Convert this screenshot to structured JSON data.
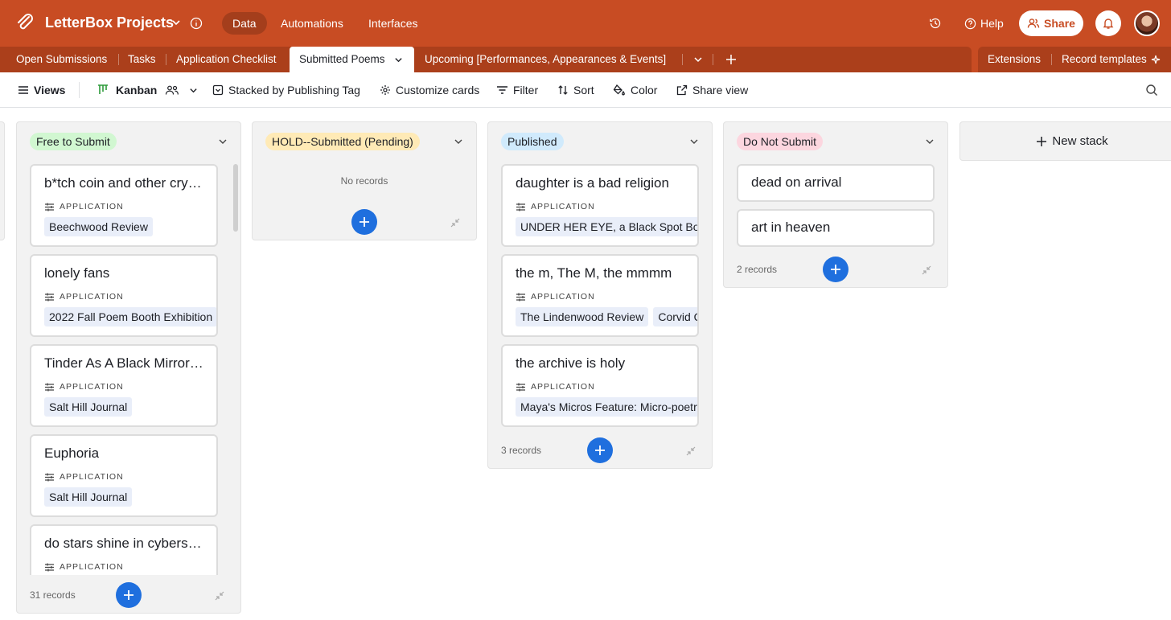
{
  "app": {
    "base_name": "LetterBox Projects",
    "nav": [
      "Data",
      "Automations",
      "Interfaces"
    ],
    "help_label": "Help",
    "share_label": "Share",
    "brand_color": "#c84c23"
  },
  "tabs": {
    "items": [
      "Open Submissions",
      "Tasks",
      "Application Checklist",
      "Submitted Poems",
      "Upcoming [Performances, Appearances & Events]"
    ],
    "active": "Submitted Poems",
    "extensions_label": "Extensions",
    "record_templates_label": "Record templates"
  },
  "viewbar": {
    "views_label": "Views",
    "view_name": "Kanban",
    "stacked_by": "Stacked by Publishing Tag",
    "customize": "Customize cards",
    "filter": "Filter",
    "sort": "Sort",
    "color": "Color",
    "share_view": "Share view"
  },
  "field_label": "APPLICATION",
  "stacks": [
    {
      "name": "Free to Submit",
      "pill_color": "#d1f7d1",
      "count_label": "31 records",
      "cards": [
        {
          "title": "b*tch coin and other cryptocurrencies",
          "chips": [
            "Beechwood Review"
          ]
        },
        {
          "title": "lonely fans",
          "chips": [
            "2022 Fall Poem Booth Exhibition"
          ]
        },
        {
          "title": "Tinder As A Black Mirror Episode",
          "chips": [
            "Salt Hill Journal"
          ]
        },
        {
          "title": "Euphoria",
          "chips": [
            "Salt Hill Journal"
          ]
        },
        {
          "title": "do stars shine in cyberspace",
          "chips": []
        }
      ]
    },
    {
      "name": "HOLD--Submitted (Pending)",
      "pill_color": "#ffeab6",
      "count_label": "",
      "empty_label": "No records",
      "cards": []
    },
    {
      "name": "Published",
      "pill_color": "#d0eafc",
      "count_label": "3 records",
      "cards": [
        {
          "title": "daughter is a bad religion",
          "chips": [
            "UNDER HER EYE, a Black Spot Books Anthology"
          ]
        },
        {
          "title": "the m, The M, the mmmm",
          "chips": [
            "The Lindenwood Review",
            "Corvid Queen"
          ]
        },
        {
          "title": "the archive is holy",
          "chips": [
            "Maya's Micros Feature: Micro-poetry"
          ]
        }
      ]
    },
    {
      "name": "Do Not Submit",
      "pill_color": "#fcd6df",
      "count_label": "2 records",
      "cards": [
        {
          "title": "dead on arrival",
          "chips": []
        },
        {
          "title": "art in heaven",
          "chips": []
        }
      ]
    }
  ],
  "new_stack_label": "New stack"
}
